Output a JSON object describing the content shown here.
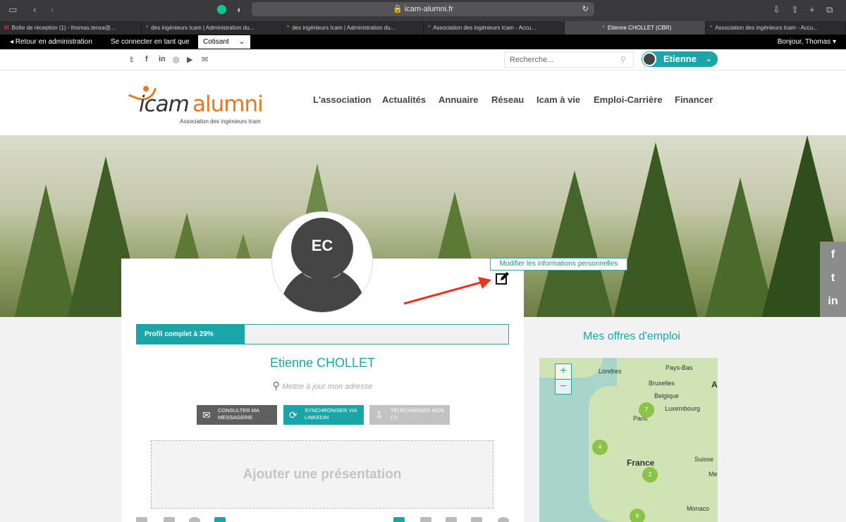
{
  "browser": {
    "url": "icam-alumni.fr",
    "tabs": [
      {
        "label": "Boîte de réception (1) - thomas.tensa@...",
        "active": false
      },
      {
        "label": "des ingénieurs Icam | Administration du...",
        "active": false
      },
      {
        "label": "des ingénieurs Icam | Administration du...",
        "active": false
      },
      {
        "label": "Association des ingénieurs Icam - Accu...",
        "active": false
      },
      {
        "label": "Etienne CHOLLET (CBR)",
        "active": true
      },
      {
        "label": "Association des ingénieurs Icam - Accu...",
        "active": false
      }
    ]
  },
  "adminbar": {
    "back": "Retour en administration",
    "connect_as": "Se connecter en tant que",
    "role": "Cotisant",
    "greeting": "Bonjour, Thomas"
  },
  "topbar": {
    "search_placeholder": "Recherche...",
    "user": "Etienne"
  },
  "header": {
    "logo_icam": "icam",
    "logo_alumni": "alumni",
    "logo_sub": "Association des ingénieurs Icam",
    "nav": [
      "L'association",
      "Actualités",
      "Annuaire",
      "Réseau",
      "Icam à vie",
      "Emploi-Carrière",
      "Financer"
    ]
  },
  "profile": {
    "initials": "EC",
    "tooltip": "Modifier les informations personnelles",
    "progress_label": "Profil complet à 29%",
    "progress": 0.29,
    "name": "Etienne CHOLLET",
    "address_prompt": "Mettre à jour mon adresse",
    "buttons": [
      {
        "label": "CONSULTER MA MESSAGERIE",
        "color": "#5f5f5f"
      },
      {
        "label": "SYNCHRONISER VIA LINKEDIN",
        "color": "#1aa6a8"
      },
      {
        "label": "TÉLÉCHARGER MON CV",
        "color": "#c2c2c2"
      }
    ],
    "presentation": "Ajouter une présentation"
  },
  "jobs": {
    "title": "Mes offres d'emploi",
    "map_labels": [
      "Londres",
      "Pays-Bas",
      "Bruxelles",
      "Belgique",
      "Luxembourg",
      "Paris",
      "France",
      "Suisse",
      "Monaco",
      "Al",
      "Me"
    ],
    "clusters": [
      "7",
      "4",
      "2",
      "9"
    ]
  },
  "colors": {
    "accent": "#1aa6a8",
    "brand_orange": "#e87722"
  }
}
